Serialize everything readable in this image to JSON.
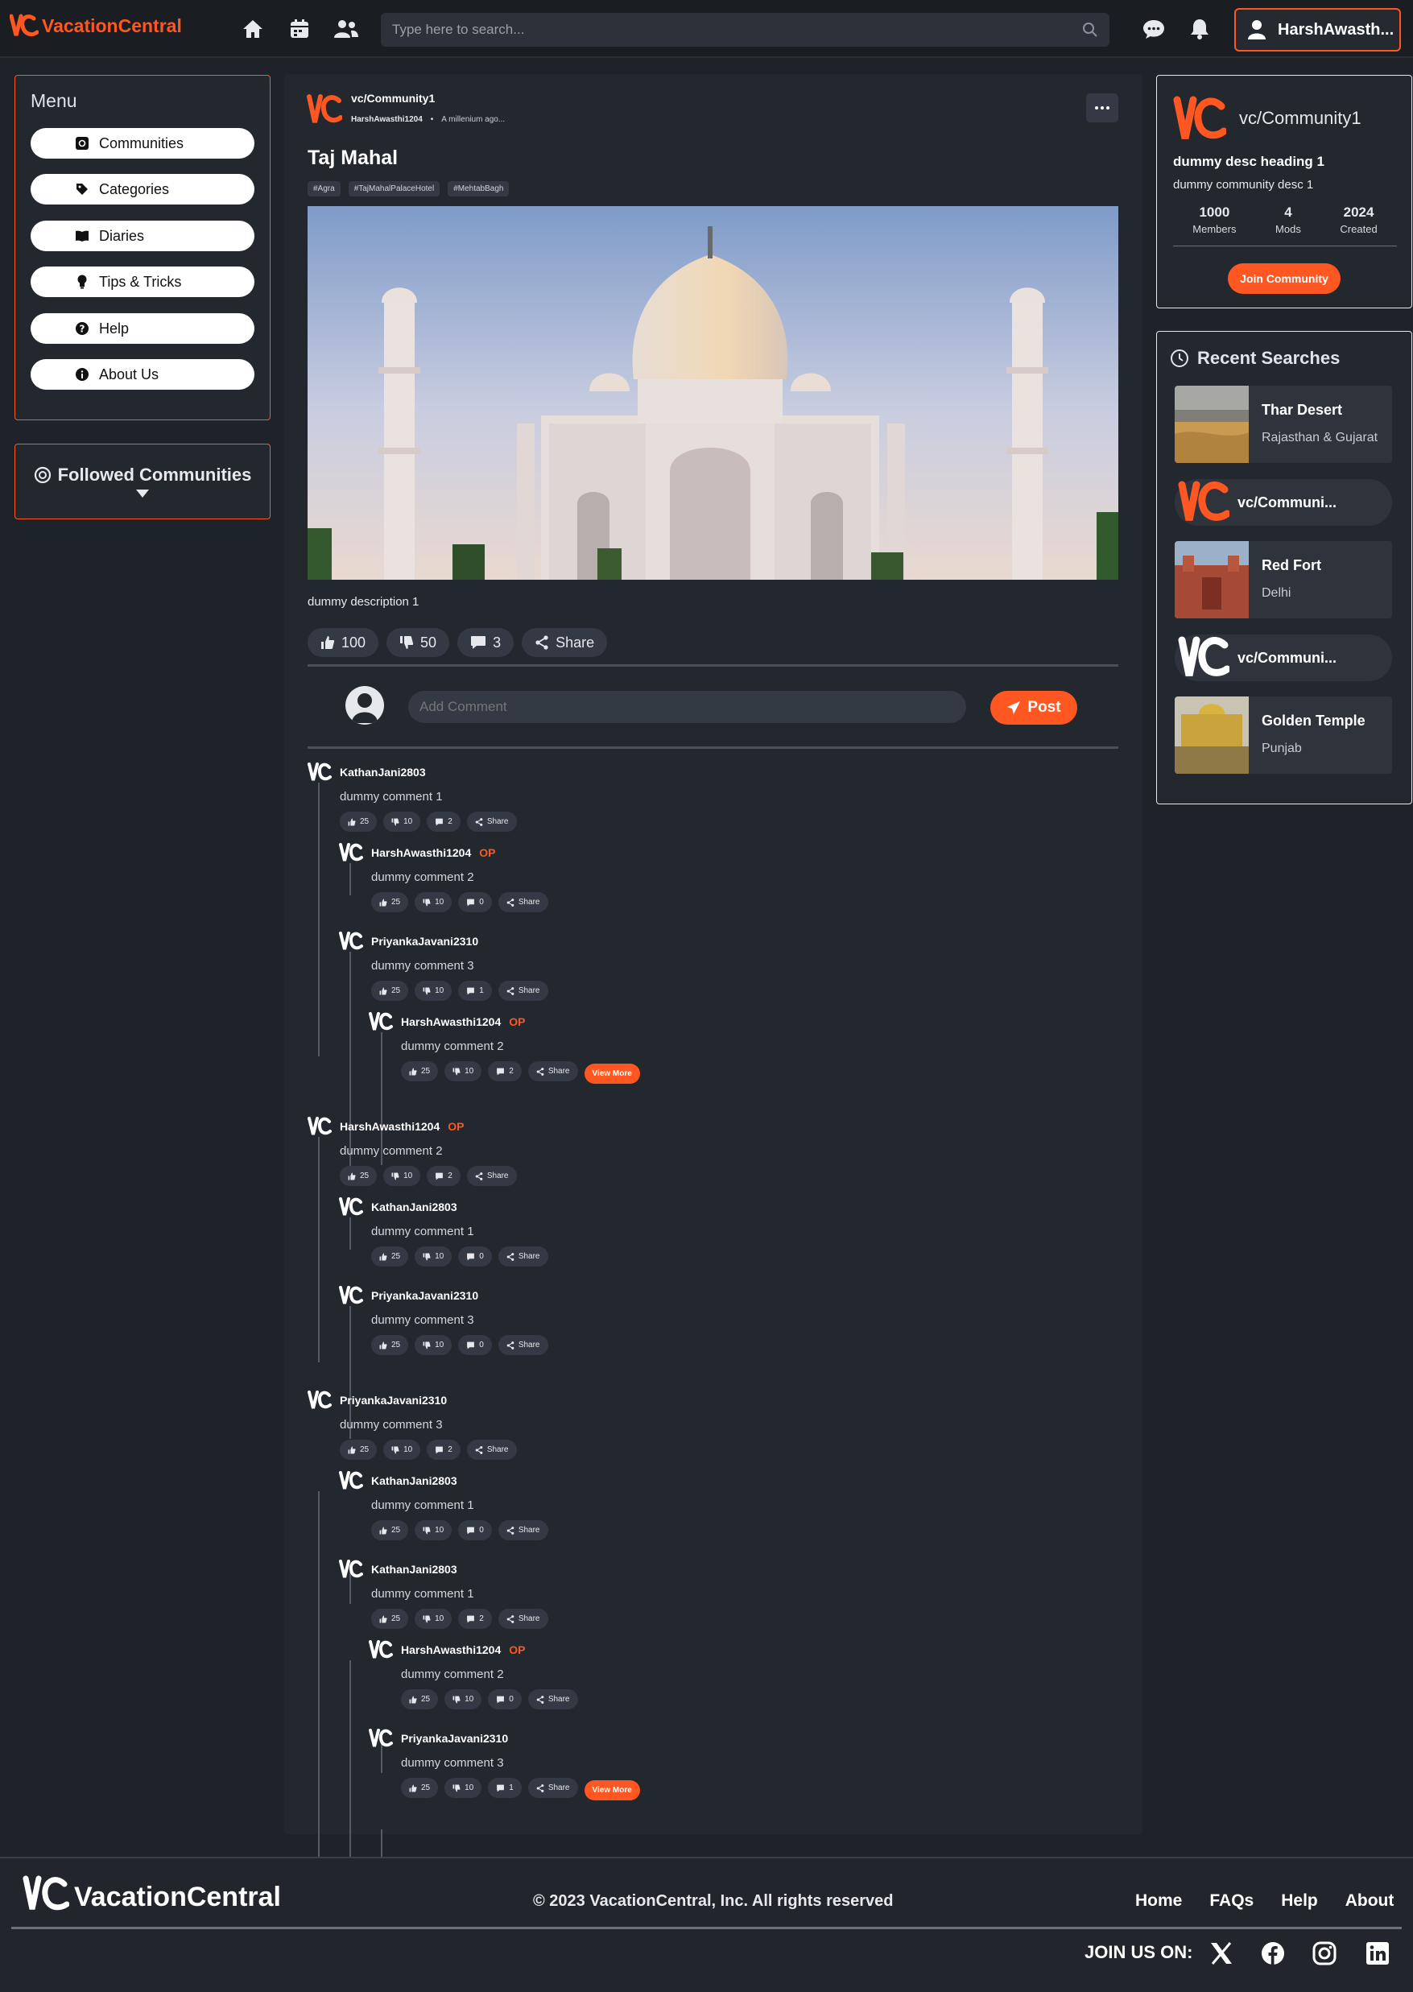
{
  "brand": {
    "name": "VacationCentral",
    "accent": "#ff5722"
  },
  "nav": {
    "search_placeholder": "Type here to search...",
    "user_name": "HarshAwasth...",
    "icons": [
      "home-icon",
      "calendar-icon",
      "users-icon",
      "chat-icon",
      "bell-icon",
      "user-icon"
    ]
  },
  "menu": {
    "title": "Menu",
    "items": [
      {
        "label": "Communities",
        "icon": "threads-icon"
      },
      {
        "label": "Categories",
        "icon": "tag-icon"
      },
      {
        "label": "Diaries",
        "icon": "book-icon"
      },
      {
        "label": "Tips & Tricks",
        "icon": "bulb-icon"
      },
      {
        "label": "Help",
        "icon": "question-icon"
      },
      {
        "label": "About Us",
        "icon": "info-icon"
      }
    ],
    "followed_title": "Followed Communities"
  },
  "post": {
    "community": "vc/Community1",
    "author": "HarshAwasthi1204",
    "time": "A millenium ago...",
    "title": "Taj Mahal",
    "tags": [
      "#Agra",
      "#TajMahalPalaceHotel",
      "#MehtabBagh"
    ],
    "description": "dummy description 1",
    "likes": "100",
    "dislikes": "50",
    "comments": "3",
    "share_label": "Share",
    "comment_placeholder": "Add Comment",
    "post_button": "Post"
  },
  "comments": [
    {
      "user": "KathanJani2803",
      "op": "",
      "text": "dummy comment 1",
      "likes": "25",
      "dislikes": "10",
      "replies": "2",
      "share": "Share",
      "more": ""
    },
    {
      "user": "HarshAwasthi1204",
      "op": "OP",
      "text": "dummy comment 2",
      "likes": "25",
      "dislikes": "10",
      "replies": "0",
      "share": "Share",
      "more": ""
    },
    {
      "user": "PriyankaJavani2310",
      "op": "",
      "text": "dummy comment 3",
      "likes": "25",
      "dislikes": "10",
      "replies": "1",
      "share": "Share",
      "more": ""
    },
    {
      "user": "HarshAwasthi1204",
      "op": "OP",
      "text": "dummy comment 2",
      "likes": "25",
      "dislikes": "10",
      "replies": "2",
      "share": "Share",
      "more": "View More"
    },
    {
      "user": "HarshAwasthi1204",
      "op": "OP",
      "text": "dummy comment 2",
      "likes": "25",
      "dislikes": "10",
      "replies": "2",
      "share": "Share",
      "more": ""
    },
    {
      "user": "KathanJani2803",
      "op": "",
      "text": "dummy comment 1",
      "likes": "25",
      "dislikes": "10",
      "replies": "0",
      "share": "Share",
      "more": ""
    },
    {
      "user": "PriyankaJavani2310",
      "op": "",
      "text": "dummy comment 3",
      "likes": "25",
      "dislikes": "10",
      "replies": "0",
      "share": "Share",
      "more": ""
    },
    {
      "user": "PriyankaJavani2310",
      "op": "",
      "text": "dummy comment 3",
      "likes": "25",
      "dislikes": "10",
      "replies": "2",
      "share": "Share",
      "more": ""
    },
    {
      "user": "KathanJani2803",
      "op": "",
      "text": "dummy comment 1",
      "likes": "25",
      "dislikes": "10",
      "replies": "0",
      "share": "Share",
      "more": ""
    },
    {
      "user": "KathanJani2803",
      "op": "",
      "text": "dummy comment 1",
      "likes": "25",
      "dislikes": "10",
      "replies": "2",
      "share": "Share",
      "more": ""
    },
    {
      "user": "HarshAwasthi1204",
      "op": "OP",
      "text": "dummy comment 2",
      "likes": "25",
      "dislikes": "10",
      "replies": "0",
      "share": "Share",
      "more": ""
    },
    {
      "user": "PriyankaJavani2310",
      "op": "",
      "text": "dummy comment 3",
      "likes": "25",
      "dislikes": "10",
      "replies": "1",
      "share": "Share",
      "more": "View More"
    }
  ],
  "community_card": {
    "name": "vc/Community1",
    "heading": "dummy desc heading 1",
    "desc": "dummy community desc 1",
    "stats": [
      {
        "value": "1000",
        "label": "Members"
      },
      {
        "value": "4",
        "label": "Mods"
      },
      {
        "value": "2024",
        "label": "Created"
      }
    ],
    "join_label": "Join Community"
  },
  "recent": {
    "title": "Recent Searches",
    "items": [
      {
        "type": "place",
        "name": "Thar Desert",
        "sub": "Rajasthan & Gujarat"
      },
      {
        "type": "community",
        "name": "vc/Communi..."
      },
      {
        "type": "place",
        "name": "Red Fort",
        "sub": "Delhi"
      },
      {
        "type": "community",
        "name": "vc/Communi..."
      },
      {
        "type": "place",
        "name": "Golden Temple",
        "sub": "Punjab"
      }
    ]
  },
  "footer": {
    "copyright": "© 2023 VacationCentral, Inc. All rights reserved",
    "links": [
      "Home",
      "FAQs",
      "Help",
      "About"
    ],
    "join_label": "JOIN US ON:",
    "social": [
      "x-icon",
      "facebook-icon",
      "instagram-icon",
      "linkedin-icon"
    ]
  }
}
